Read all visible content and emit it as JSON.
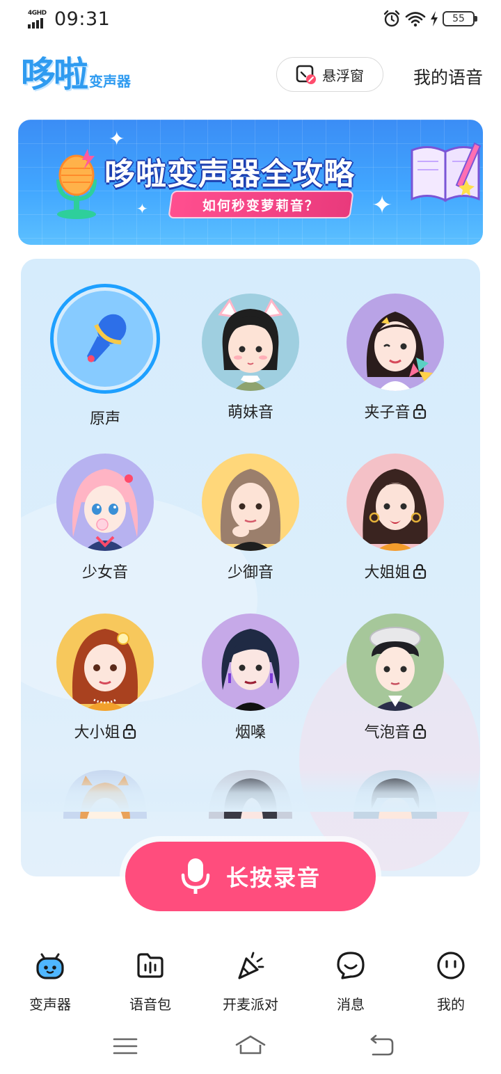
{
  "status_bar": {
    "network": "4GHD",
    "time": "09:31",
    "battery": "55"
  },
  "header": {
    "logo_main": "哆啦",
    "logo_sub": "变声器",
    "float_window_label": "悬浮窗",
    "my_voice_label": "我的语音"
  },
  "banner": {
    "title": "哆啦变声器全攻略",
    "subtitle": "如何秒变萝莉音？"
  },
  "voices": [
    {
      "label": "原声",
      "locked": false,
      "selected": true
    },
    {
      "label": "萌妹音",
      "locked": false,
      "selected": false
    },
    {
      "label": "夹子音",
      "locked": true,
      "selected": false
    },
    {
      "label": "少女音",
      "locked": false,
      "selected": false
    },
    {
      "label": "少御音",
      "locked": false,
      "selected": false
    },
    {
      "label": "大姐姐",
      "locked": true,
      "selected": false
    },
    {
      "label": "大小姐",
      "locked": true,
      "selected": false
    },
    {
      "label": "烟嗓",
      "locked": false,
      "selected": false
    },
    {
      "label": "气泡音",
      "locked": true,
      "selected": false
    }
  ],
  "record_button": {
    "label": "长按录音"
  },
  "bottom_nav": [
    {
      "label": "变声器",
      "icon": "robot-face-icon",
      "active": true
    },
    {
      "label": "语音包",
      "icon": "folder-voice-icon",
      "active": false
    },
    {
      "label": "开麦派对",
      "icon": "party-popper-icon",
      "active": false
    },
    {
      "label": "消息",
      "icon": "chat-bubble-icon",
      "active": false
    },
    {
      "label": "我的",
      "icon": "smile-face-icon",
      "active": false
    }
  ],
  "colors": {
    "brand_blue": "#2f9bf0",
    "record_pink": "#ff4d7d",
    "selected_ring": "#1ea0ff",
    "panel_bg": "#d6ecfc"
  }
}
